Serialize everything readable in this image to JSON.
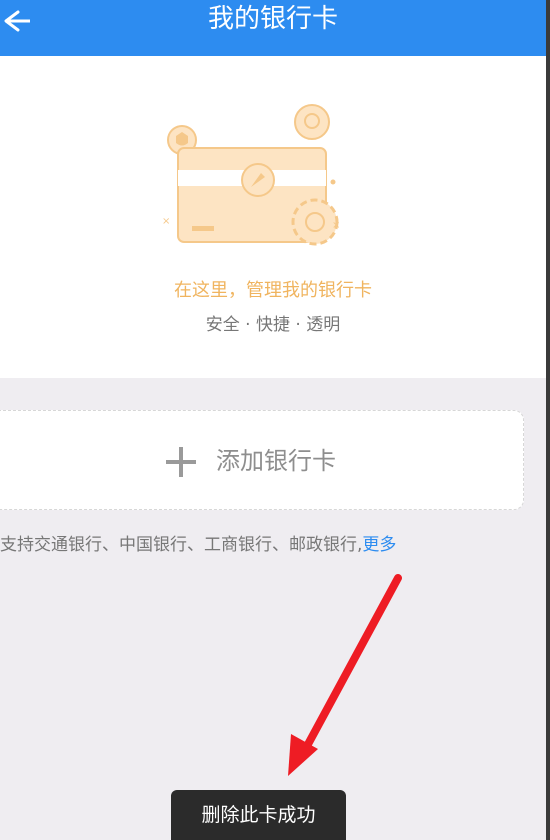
{
  "header": {
    "title": "我的银行卡"
  },
  "hero": {
    "tagline": "在这里，管理我的银行卡",
    "features": "安全 · 快捷 · 透明"
  },
  "add_card": {
    "label": "添加银行卡"
  },
  "support": {
    "text": "支持交通银行、中国银行、工商银行、邮政银行,",
    "more": "更多"
  },
  "toast": {
    "text": "删除此卡成功"
  },
  "colors": {
    "header": "#2d8cf0",
    "accent": "#f0b45f",
    "link": "#2d8cf0",
    "arrow": "#ee1c24"
  }
}
